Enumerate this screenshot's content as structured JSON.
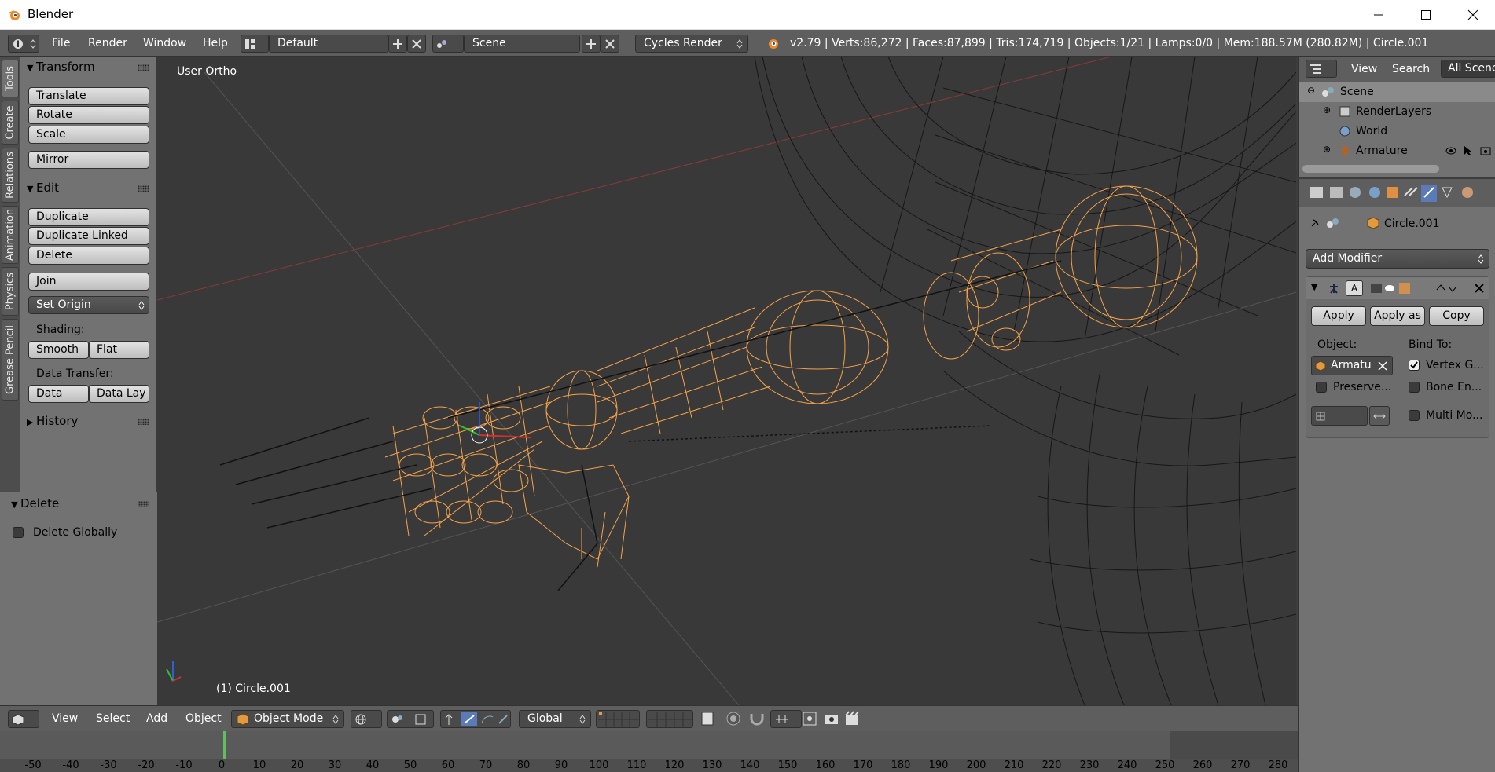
{
  "window": {
    "title": "Blender"
  },
  "topbar": {
    "menus": [
      "File",
      "Render",
      "Window",
      "Help"
    ],
    "layout": "Default",
    "scene": "Scene",
    "engine": "Cycles Render",
    "stats": "v2.79 | Verts:86,272 | Faces:87,899 | Tris:174,719 | Objects:1/21 | Lamps:0/0 | Mem:188.57M (280.82M) | Circle.001"
  },
  "tabs": [
    "Tools",
    "Create",
    "Relations",
    "Animation",
    "Physics",
    "Grease Pencil"
  ],
  "toolshelf": {
    "transform_title": "Transform",
    "translate": "Translate",
    "rotate": "Rotate",
    "scale": "Scale",
    "mirror": "Mirror",
    "edit_title": "Edit",
    "duplicate": "Duplicate",
    "duplicate_linked": "Duplicate Linked",
    "delete": "Delete",
    "join": "Join",
    "set_origin": "Set Origin",
    "shading_label": "Shading:",
    "smooth": "Smooth",
    "flat": "Flat",
    "data_transfer_label": "Data Transfer:",
    "data": "Data",
    "data_lay": "Data Lay",
    "history_title": "History",
    "op_title": "Delete",
    "delete_globally": "Delete Globally"
  },
  "viewport": {
    "view_label": "User Ortho",
    "object_label": "(1) Circle.001",
    "wire_color": "#f5a34a"
  },
  "outliner": {
    "menus": [
      "View",
      "Search"
    ],
    "filter": "All Scenes",
    "items": [
      "Scene",
      "RenderLayers",
      "World",
      "Armature"
    ]
  },
  "properties": {
    "object_name": "Circle.001",
    "add_modifier": "Add Modifier",
    "apply": "Apply",
    "apply_as": "Apply as",
    "copy": "Copy",
    "object_label": "Object:",
    "object_value": "Armatu",
    "bind_to_label": "Bind To:",
    "vertex_groups": "Vertex G...",
    "preserve": "Preserve...",
    "bone_envelopes": "Bone En...",
    "multi_modifier": "Multi Mo..."
  },
  "bottombar": {
    "menus": [
      "View",
      "Select",
      "Add",
      "Object"
    ],
    "mode": "Object Mode",
    "orientation": "Global"
  },
  "timeline": {
    "ticks": [
      "-50",
      "-40",
      "-30",
      "-20",
      "-10",
      "0",
      "10",
      "20",
      "30",
      "40",
      "50",
      "60",
      "70",
      "80",
      "90",
      "100",
      "110",
      "120",
      "130",
      "140",
      "150",
      "160",
      "170",
      "180",
      "190",
      "200",
      "210",
      "220",
      "230",
      "240",
      "250",
      "260",
      "270",
      "280"
    ]
  }
}
